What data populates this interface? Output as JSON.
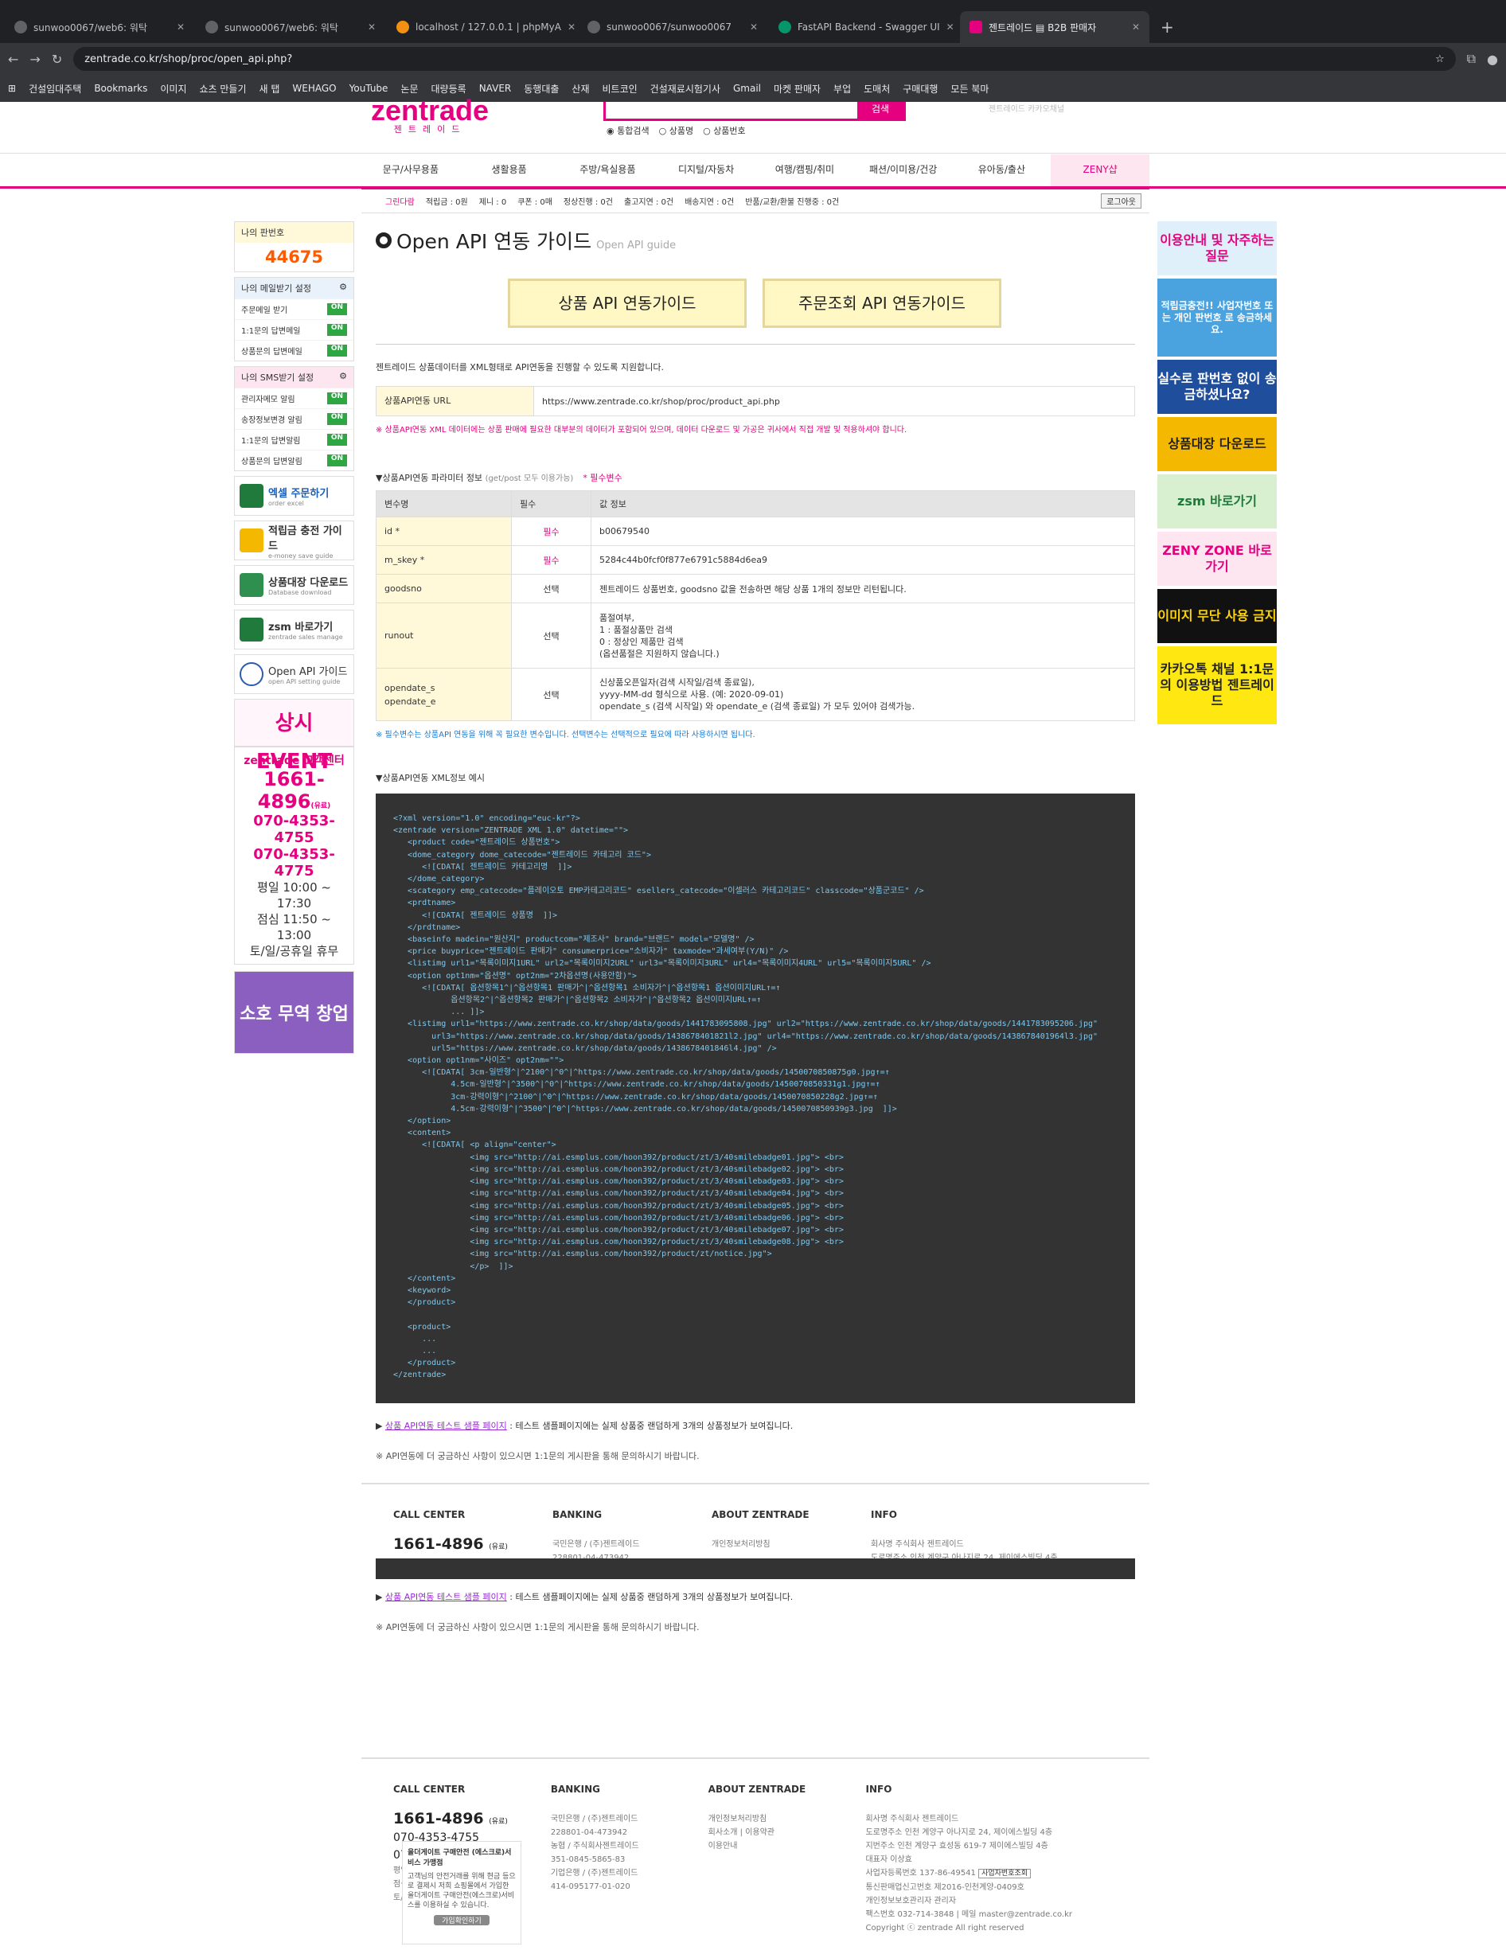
{
  "browser": {
    "tabs": [
      "sunwoo0067/web6: 워탁",
      "sunwoo0067/web6: 워탁",
      "localhost / 127.0.0.1 | phpMyA",
      "sunwoo0067/sunwoo0067",
      "FastAPI Backend - Swagger UI",
      "젠트레이드 ▤ B2B 판매자"
    ],
    "url": "zentrade.co.kr/shop/proc/open_api.php?",
    "bookmarks": [
      "건설임대주택",
      "Bookmarks",
      "이미지",
      "쇼츠 만들기",
      "새 탭",
      "WEHAGO",
      "YouTube",
      "논문",
      "대량등록",
      "NAVER",
      "동행대출",
      "산재",
      "비트코인",
      "건설재료시험기사",
      "Gmail",
      "마켓 판매자",
      "부업",
      "도매처",
      "구매대행",
      "모든 북마"
    ]
  },
  "header": {
    "logo": "zentrade",
    "logo_sub": "젠트레이드",
    "search_btn": "검색",
    "radios": [
      "통합검색",
      "상품명",
      "상품번호"
    ],
    "right_hint": "젠트레이드 카카오채널"
  },
  "nav": [
    "문구/사무용품",
    "생활용품",
    "주방/욕실용품",
    "디지털/자동차",
    "여행/캠핑/취미",
    "패션/이미용/건강",
    "유아동/출산",
    "ZENY샵"
  ],
  "status": {
    "grade": "그린다람",
    "items": [
      "적립금 : 0원",
      "제니 : 0",
      "쿠폰 : 0매",
      "정상진행 : 0건",
      "출고지연 : 0건",
      "배송지연 : 0건",
      "반품/교환/환불 진행중 : 0건"
    ],
    "logout": "로그아웃"
  },
  "left": {
    "seller_label": "나의 판번호",
    "seller_no": "44675",
    "mail_title": "나의 메일받기 설정",
    "mail": [
      "주문메일 받기",
      "1:1문의 답변메일",
      "상품문의 답변메일"
    ],
    "sms_title": "나의 SMS받기 설정",
    "sms": [
      "관리자메모 알림",
      "송장정보변경 알림",
      "1:1문의 답변알림",
      "상품문의 답변알림"
    ],
    "on": "ON",
    "buttons": [
      {
        "t": "엑셀 주문하기",
        "s": "order excel"
      },
      {
        "t": "적립금 충전 가이드",
        "s": "e-money save guide"
      },
      {
        "t": "상품대장 다운로드",
        "s": "Database download"
      },
      {
        "t": "zsm 바로가기",
        "s": "zentrade sales manage"
      },
      {
        "t": "Open API 가이드",
        "s": "open API setting guide"
      }
    ],
    "event": "상시EVENT",
    "cs_title": "zentrade 고객센터",
    "cs_phone": "1661-4896",
    "cs_phone_note": "(유료)",
    "cs_p1": "070-4353-4755",
    "cs_p2": "070-4353-4775",
    "cs_h1": "평일 10:00 ~ 17:30",
    "cs_h2": "점심 11:50 ~ 13:00",
    "cs_h3": "토/일/공휴일 휴무",
    "promo": "소호 무역 창업"
  },
  "right": [
    "이용안내 및 자주하는 질문",
    "적립금충전!! 사업자번호 또는 개인 판번호 로 송금하세요.",
    "실수로 판번호 없이 송금하셨나요?",
    "상품대장 다운로드",
    "zsm 바로가기",
    "ZENY ZONE 바로가기",
    "이미지 무단 사용 금지",
    "카카오톡 채널 1:1문의 이용방법 젠트레이드"
  ],
  "main": {
    "title": "Open API 연동 가이드",
    "title_sub": "Open API guide",
    "guide1": "상품 API 연동가이드",
    "guide2": "주문조회 API 연동가이드",
    "intro": "젠트레이드 상품데이터를 XML형태로 API연동을 진행할 수 있도록 지원합니다.",
    "url_key": "상품API연동 URL",
    "url_val": "https://www.zentrade.co.kr/shop/proc/product_api.php",
    "warn": "※ 상품API연동 XML 데이터에는 상품 판매에 필요한 대부분의 데이터가 포함되어 있으며, 데이터 다운로드 및 가공은 귀사에서 직접 개발 및 적용하셔야 합니다.",
    "param_title": "▼상품API연동 파라미터 정보",
    "param_sub": "(get/post 모두 이용가능)",
    "param_req": "* 필수변수",
    "th": [
      "변수명",
      "필수",
      "값 정보"
    ],
    "rows": [
      {
        "k": "id *",
        "r": "필수",
        "v": "b00679540"
      },
      {
        "k": "m_skey *",
        "r": "필수",
        "v": "5284c44b0fcf0f877e6791c5884d6ea9"
      },
      {
        "k": "goodsno",
        "r": "선택",
        "v": "젠트레이드 상품번호, goodsno 값을 전송하면 해당 상품 1개의 정보만 리턴됩니다."
      },
      {
        "k": "runout",
        "r": "선택",
        "v": "품절여부,\n1 : 품절상품만 검색\n0 : 정상인 제품만 검색\n(옵션품절은 지원하지 않습니다.)"
      },
      {
        "k": "opendate_s\nopendate_e",
        "r": "선택",
        "v": "신상품오픈일자(검색 시작일/검색 종료일),\nyyyy-MM-dd 형식으로 사용. (예: 2020-09-01)\nopendate_s (검색 시작일) 와 opendate_e (검색 종료일) 가 모두 있어야 검색가능."
      }
    ],
    "note": "※ 필수변수는 상품API 연동을 위해 꼭 필요한 변수입니다. 선택변수는 선택적으로 필요에 따라 사용하시면 됩니다.",
    "xml_title": "▼상품API연동 XML정보 예시",
    "xml": "<?xml version=\"1.0\" encoding=\"euc-kr\"?>\n<zentrade version=\"ZENTRADE XML 1.0\" datetime=\"\">\n   <product code=\"젠트레이드 상품번호\">\n   <dome_category dome_catecode=\"젠트레이드 카테고리 코드\">\n      <![CDATA[ 젠트레이드 카테고리명  ]]>\n   </dome_category>\n   <scategory emp_catecode=\"플레이오토 EMP카테고리코드\" esellers_catecode=\"이셀러스 카테고리코드\" classcode=\"상품군코드\" />\n   <prdtname>\n      <![CDATA[ 젠트레이드 상품명  ]]>\n   </prdtname>\n   <baseinfo madein=\"원산지\" productcom=\"제조사\" brand=\"브랜드\" model=\"모델명\" />\n   <price buyprice=\"젠트레이드 판매가\" consumerprice=\"소비자가\" taxmode=\"과세여부(Y/N)\" />\n   <listimg url1=\"목록이미지1URL\" url2=\"목록이미지2URL\" url3=\"목록이미지3URL\" url4=\"목록이미지4URL\" url5=\"목록이미지5URL\" />\n   <option opt1nm=\"옵션명\" opt2nm=\"2차옵션명(사용안함)\">\n      <![CDATA[ 옵션항목1^|^옵션항목1 판매가^|^옵션항목1 소비자가^|^옵션항목1 옵션이미지URL↑=↑\n            옵션항목2^|^옵션항목2 판매가^|^옵션항목2 소비자가^|^옵션항목2 옵션이미지URL↑=↑\n            ... ]]>\n   <listimg url1=\"https://www.zentrade.co.kr/shop/data/goods/1441783095808.jpg\" url2=\"https://www.zentrade.co.kr/shop/data/goods/1441783095206.jpg\"\n        url3=\"https://www.zentrade.co.kr/shop/data/goods/1438678401821l2.jpg\" url4=\"https://www.zentrade.co.kr/shop/data/goods/1438678401964l3.jpg\"\n        url5=\"https://www.zentrade.co.kr/shop/data/goods/1438678401846l4.jpg\" />\n   <option opt1nm=\"사이즈\" opt2nm=\"\">\n      <![CDATA[ 3cm-일반형^|^2100^|^0^|^https://www.zentrade.co.kr/shop/data/goods/1450070850875g0.jpg↑=↑\n            4.5cm-일반형^|^3500^|^0^|^https://www.zentrade.co.kr/shop/data/goods/1450070850331g1.jpg↑=↑\n            3cm-강력이형^|^2100^|^0^|^https://www.zentrade.co.kr/shop/data/goods/1450070850228g2.jpg↑=↑\n            4.5cm-강력이형^|^3500^|^0^|^https://www.zentrade.co.kr/shop/data/goods/1450070850939g3.jpg  ]]>\n   </option>\n   <content>\n      <![CDATA[ <p align=\"center\">\n                <img src=\"http://ai.esmplus.com/hoon392/product/zt/3/40smilebadge01.jpg\"> <br>\n                <img src=\"http://ai.esmplus.com/hoon392/product/zt/3/40smilebadge02.jpg\"> <br>\n                <img src=\"http://ai.esmplus.com/hoon392/product/zt/3/40smilebadge03.jpg\"> <br>\n                <img src=\"http://ai.esmplus.com/hoon392/product/zt/3/40smilebadge04.jpg\"> <br>\n                <img src=\"http://ai.esmplus.com/hoon392/product/zt/3/40smilebadge05.jpg\"> <br>\n                <img src=\"http://ai.esmplus.com/hoon392/product/zt/3/40smilebadge06.jpg\"> <br>\n                <img src=\"http://ai.esmplus.com/hoon392/product/zt/3/40smilebadge07.jpg\"> <br>\n                <img src=\"http://ai.esmplus.com/hoon392/product/zt/3/40smilebadge08.jpg\"> <br>\n                <img src=\"http://ai.esmplus.com/hoon392/product/zt/notice.jpg\">\n                </p>  ]]>\n   </content>\n   <keyword>\n   </product>\n\n   <product>\n      ...\n      ...\n   </product>\n</zentrade>",
    "link_text": "상품 API연동 테스트 샘플 페이지",
    "link_rest": " : 테스트 샘플페이지에는 실제 상품중 랜덤하게 3개의 상품정보가 보여집니다.",
    "help": "※ API연동에 더 궁금하신 사항이 있으시면 1:1문의 게시판을 통해 문의하시기 바랍니다."
  },
  "footer": {
    "cc_title": "CALL CENTER",
    "cc_phone": "1661-4896",
    "cc_note": "(유료)",
    "cc_p1": "070-4353-4755",
    "cc_p2": "070-4353-4775",
    "cc_h": [
      "평일 10:00 - 17:30",
      "점심 11:50 - 13:00",
      "토/일요일,공휴일 휴무"
    ],
    "bank_title": "BANKING",
    "bank": [
      "국민은행 / (주)젠트레이드",
      "228801-04-473942",
      "농협 / 주식회사젠트레이드",
      "351-0845-5865-83",
      "기업은행 / (주)젠트레이드",
      "414-095177-01-020"
    ],
    "about_title": "ABOUT ZENTRADE",
    "about": [
      "개인정보처리방침",
      "회사소개",
      "이용약관",
      "이용안내"
    ],
    "info_title": "INFO",
    "info": [
      "회사명 주식회사 젠트레이드",
      "도로명주소 인천 계양구 아나지로 24, 제이에스빌딩 4층",
      "지번주소 인천 계양구 효성동 619-7 제이에스빌딩 4층",
      "대표자 이상효",
      "사업자등록번호 137-86-49541",
      "통신판매업신고번호 제2016-인천계양-0409호",
      "개인정보보호관리자 관리자",
      "팩스번호 032-714-3848 | 메일 master@zentrade.co.kr",
      "Copyright ⓒ zentrade All right reserved"
    ],
    "biz_btn": "사업자번호조회",
    "escrow_title": "올더게이트 구매안전 (에스크로)서비스 가맹점",
    "escrow_text": "고객님의 안전거래를 위해 현금 등으로 결제시 저희 쇼핑몰에서 가입한 올더게이트 구매안전(에스크로)서비스를 이용하실 수 있습니다.",
    "escrow_btn": "가입확인하기"
  }
}
